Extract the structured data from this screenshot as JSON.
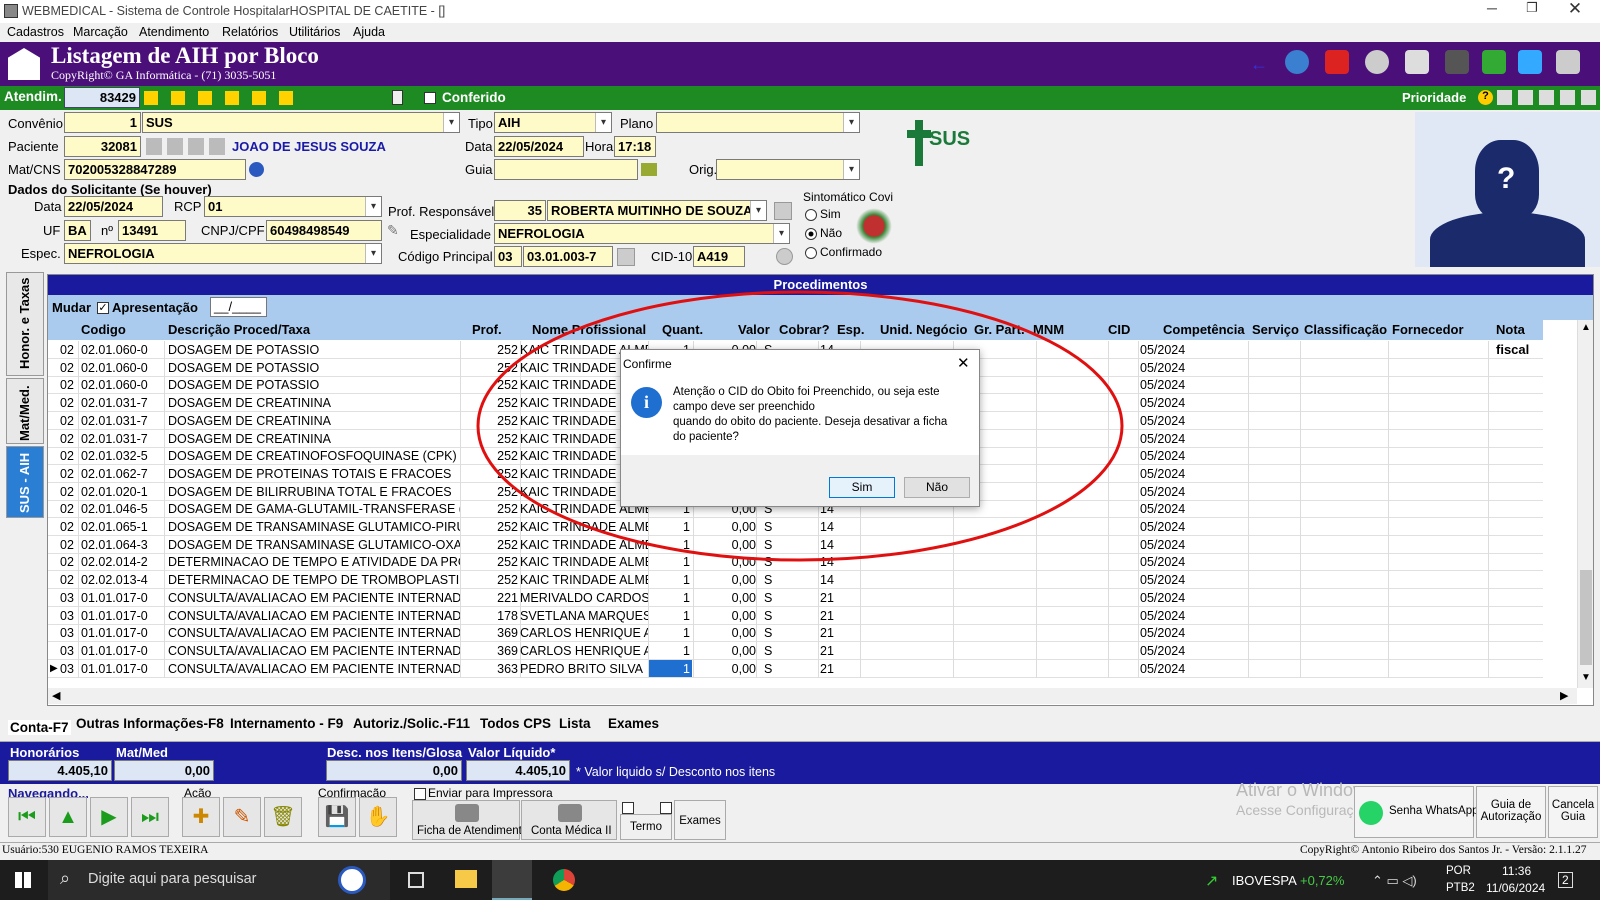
{
  "window": {
    "title": "WEBMEDICAL - Sistema de Controle HospitalarHOSPITAL DE CAETITE - []"
  },
  "menu": [
    "Cadastros",
    "Marcação",
    "Atendimento",
    "Relatórios",
    "Utilitários",
    "Ajuda"
  ],
  "header": {
    "title": "Listagem de AIH por Bloco",
    "copyright": "CopyRight© GA Informática - (71) 3035-5051"
  },
  "bar": {
    "atend_label": "Atendim.",
    "atend_value": "83429",
    "conferido": "Conferido",
    "prioridade": "Prioridade"
  },
  "form": {
    "convenio_label": "Convênio",
    "convenio_code": "1",
    "convenio_name": "SUS",
    "tipo_label": "Tipo",
    "tipo_value": "AIH",
    "plano_label": "Plano",
    "paciente_label": "Paciente",
    "paciente_code": "32081",
    "paciente_name": "JOAO DE JESUS SOUZA",
    "data_label": "Data",
    "data_value": "22/05/2024",
    "hora_label": "Hora",
    "hora_value": "17:18",
    "matcns_label": "Mat/CNS",
    "matcns_value": "702005328847289",
    "guia_label": "Guia",
    "orig_label": "Orig.",
    "solicitante_title": "Dados do Solicitante (Se houver)",
    "sol_data_label": "Data",
    "sol_data_value": "22/05/2024",
    "rcp_label": "RCP",
    "rcp_value": "01",
    "uf_label": "UF",
    "uf_value": "BA",
    "n_label": "nº",
    "n_value": "13491",
    "cnpj_label": "CNPJ/CPF",
    "cnpj_value": "60498498549",
    "espec_label": "Espec.",
    "espec_value": "NEFROLOGIA",
    "prof_label": "Prof. Responsável",
    "prof_code": "35",
    "prof_name": "ROBERTA MUITINHO DE SOUZA",
    "especialidade_label": "Especialidade",
    "especialidade_value": "NEFROLOGIA",
    "codprinc_label": "Código Principal",
    "codprinc_a": "03",
    "codprinc_b": "03.01.003-7",
    "cid_label": "CID-10",
    "cid_value": "A419",
    "sint_title": "Sintomático Covi",
    "sint_opts": [
      "Sim",
      "Não",
      "Confirmado"
    ],
    "sus_logo": "SUS"
  },
  "tabs_left": [
    "Honor. e Taxas",
    "Mat/Med.",
    "SUS - AIH"
  ],
  "proc": {
    "title": "Procedimentos",
    "mudar": "Mudar",
    "apresentacao": "Apresentação",
    "apres_value": "__/____",
    "columns": [
      "Codigo",
      "Descrição Proced/Taxa",
      "Prof.",
      "Nome Profissional",
      "Quant.",
      "Valor",
      "Cobrar?",
      "Esp.",
      "Unid. Negócio",
      "Gr. Part.",
      "MNM",
      "CID",
      "Competência",
      "Serviço",
      "Classificação",
      "Fornecedor",
      "Nota fiscal"
    ],
    "rows": [
      [
        "02",
        "02.01.060-0",
        "DOSAGEM DE POTASSIO",
        "252",
        "KAIC TRINDADE ALME",
        "1",
        "0,00",
        "S",
        "14",
        "05/2024"
      ],
      [
        "02",
        "02.01.060-0",
        "DOSAGEM DE POTASSIO",
        "252",
        "KAIC TRINDADE",
        "",
        "",
        "",
        "",
        "05/2024"
      ],
      [
        "02",
        "02.01.060-0",
        "DOSAGEM DE POTASSIO",
        "252",
        "KAIC TRINDADE",
        "",
        "",
        "",
        "",
        "05/2024"
      ],
      [
        "02",
        "02.01.031-7",
        "DOSAGEM DE CREATININA",
        "252",
        "KAIC TRINDADE",
        "",
        "",
        "",
        "",
        "05/2024"
      ],
      [
        "02",
        "02.01.031-7",
        "DOSAGEM DE CREATININA",
        "252",
        "KAIC TRINDADE",
        "",
        "",
        "",
        "",
        "05/2024"
      ],
      [
        "02",
        "02.01.031-7",
        "DOSAGEM DE CREATININA",
        "252",
        "KAIC TRINDADE",
        "",
        "",
        "",
        "",
        "05/2024"
      ],
      [
        "02",
        "02.01.032-5",
        "DOSAGEM DE CREATINOFOSFOQUINASE (CPK)",
        "252",
        "KAIC TRINDADE",
        "",
        "",
        "",
        "",
        "05/2024"
      ],
      [
        "02",
        "02.01.062-7",
        "DOSAGEM DE PROTEINAS TOTAIS E FRACOES",
        "252",
        "KAIC TRINDADE",
        "",
        "",
        "",
        "",
        "05/2024"
      ],
      [
        "02",
        "02.01.020-1",
        "DOSAGEM DE BILIRRUBINA TOTAL E FRACOES",
        "252",
        "KAIC TRINDADE",
        "",
        "",
        "",
        "",
        "05/2024"
      ],
      [
        "02",
        "02.01.046-5",
        "DOSAGEM DE GAMA-GLUTAMIL-TRANSFERASE (GAM",
        "252",
        "KAIC TRINDADE ALME",
        "1",
        "0,00",
        "S",
        "14",
        "05/2024"
      ],
      [
        "02",
        "02.01.065-1",
        "DOSAGEM DE TRANSAMINASE GLUTAMICO-PIRUVIC",
        "252",
        "KAIC TRINDADE ALME",
        "1",
        "0,00",
        "S",
        "14",
        "05/2024"
      ],
      [
        "02",
        "02.01.064-3",
        "DOSAGEM DE TRANSAMINASE GLUTAMICO-OXALACI",
        "252",
        "KAIC TRINDADE ALME",
        "1",
        "0,00",
        "S",
        "14",
        "05/2024"
      ],
      [
        "02",
        "02.02.014-2",
        "DETERMINACAO DE TEMPO E ATIVIDADE DA PROTR",
        "252",
        "KAIC TRINDADE ALME",
        "1",
        "0,00",
        "S",
        "14",
        "05/2024"
      ],
      [
        "02",
        "02.02.013-4",
        "DETERMINACAO DE TEMPO DE TROMBOPLASTINA F",
        "252",
        "KAIC TRINDADE ALME",
        "1",
        "0,00",
        "S",
        "14",
        "05/2024"
      ],
      [
        "03",
        "01.01.017-0",
        "CONSULTA/AVALIACAO EM PACIENTE INTERNADO",
        "221",
        "MERIVALDO CARDOSO",
        "1",
        "0,00",
        "S",
        "21",
        "05/2024"
      ],
      [
        "03",
        "01.01.017-0",
        "CONSULTA/AVALIACAO EM PACIENTE INTERNADO",
        "178",
        "SVETLANA MARQUES",
        "1",
        "0,00",
        "S",
        "21",
        "05/2024"
      ],
      [
        "03",
        "01.01.017-0",
        "CONSULTA/AVALIACAO EM PACIENTE INTERNADO",
        "369",
        "CARLOS HENRIQUE A",
        "1",
        "0,00",
        "S",
        "21",
        "05/2024"
      ],
      [
        "03",
        "01.01.017-0",
        "CONSULTA/AVALIACAO EM PACIENTE INTERNADO",
        "369",
        "CARLOS HENRIQUE A",
        "1",
        "0,00",
        "S",
        "21",
        "05/2024"
      ],
      [
        "03",
        "01.01.017-0",
        "CONSULTA/AVALIACAO EM PACIENTE INTERNADO",
        "363",
        "PEDRO BRITO SILVA",
        "1",
        "0,00",
        "S",
        "21",
        "05/2024"
      ]
    ]
  },
  "bottom_tabs": [
    "Conta-F7",
    "Outras Informações-F8",
    "Internamento - F9",
    "Autoriz./Solic.-F11",
    "Todos CPS",
    "Lista",
    "Exames"
  ],
  "totals": {
    "honorarios_label": "Honorários",
    "honorarios": "4.405,10",
    "matmed_label": "Mat/Med",
    "matmed": "0,00",
    "desc_label": "Desc. nos Itens/Glosa",
    "desc": "0,00",
    "liquido_label": "Valor Líquido*",
    "liquido": "4.405,10",
    "note": "* Valor liquido s/ Desconto nos itens"
  },
  "toolbar": {
    "navegando": "Navegando...",
    "acao": "Ação",
    "confirmacao": "Confirmação",
    "enviar": "Enviar para Impressora",
    "ficha": "Ficha de Atendimento",
    "conta": "Conta Médica II",
    "termo": "Termo",
    "exames": "Exames",
    "whatsapp": "Senha WhatsApp",
    "guia_aut": "Guia de Autorização",
    "cancela": "Cancela Guia"
  },
  "watermark": {
    "line1": "Ativar o Windows",
    "line2": "Acesse Configurações"
  },
  "status": {
    "usuario": "Usuário:530 EUGENIO RAMOS TEXEIRA",
    "copyright": "CopyRight© Antonio Ribeiro dos Santos Jr. - Versão: 2.1.1.27"
  },
  "dialog": {
    "title": "Confirme",
    "message1": "Atenção o CID do Obito foi Preenchido, ou seja este",
    "message2": "campo deve ser preenchido",
    "message3": "quando do obito do paciente. Deseja desativar a ficha",
    "message4": "do paciente?",
    "yes": "Sim",
    "no": "Não"
  },
  "taskbar": {
    "search": "Digite aqui para pesquisar",
    "stock": "IBOVESPA",
    "stock_change": "+0,72%",
    "lang1": "POR",
    "lang2": "PTB2",
    "time": "11:36",
    "date": "11/06/2024",
    "notif": "2"
  },
  "colors": {
    "purple": "#4b0f7a",
    "green": "#1e8a22",
    "header_blue": "#1a1a9e",
    "yellow": "#fffbc8",
    "annotation": "#e01010"
  }
}
